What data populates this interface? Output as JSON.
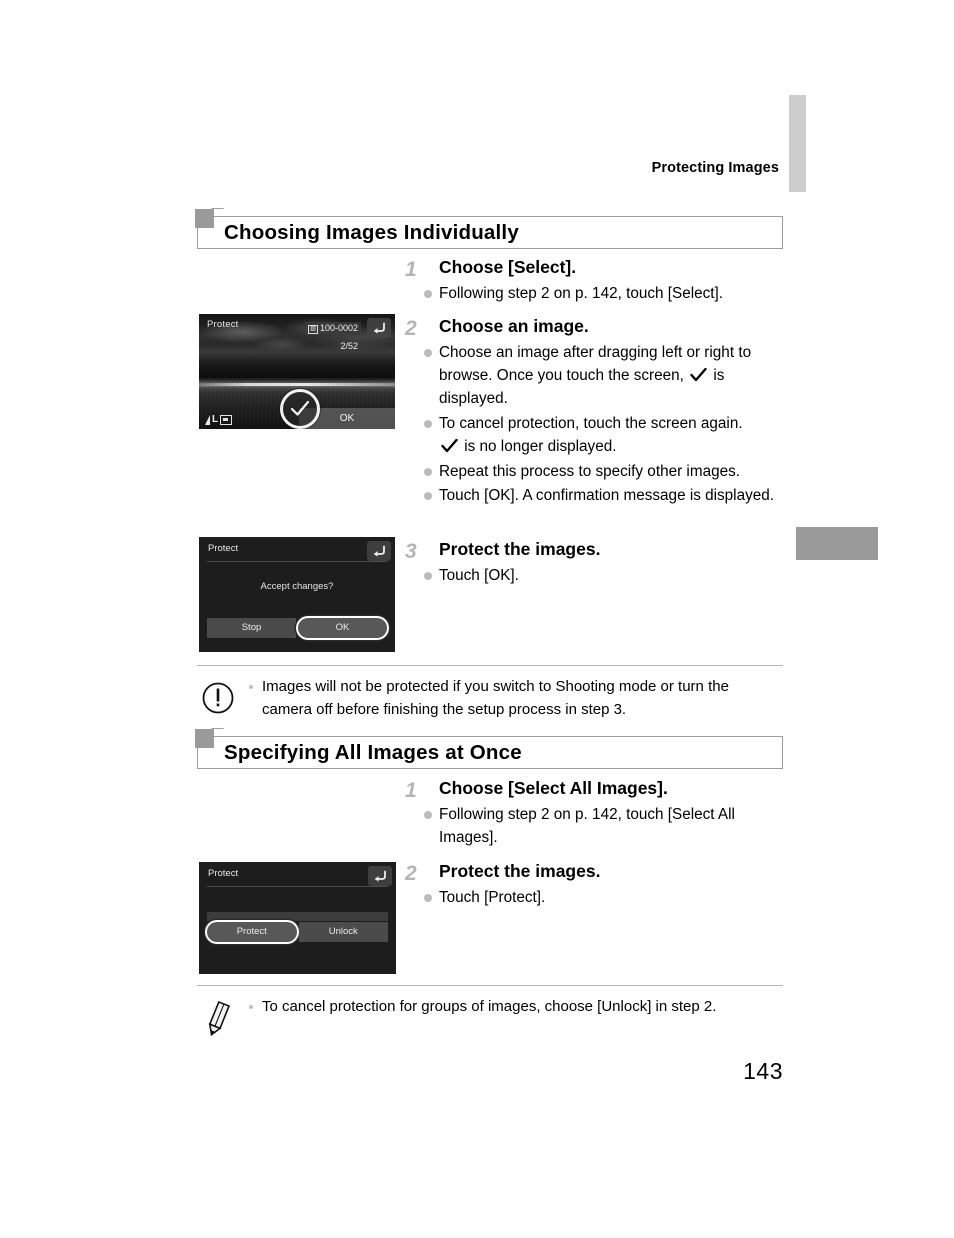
{
  "page": {
    "running_header": "Protecting Images",
    "page_number": "143"
  },
  "sections": [
    {
      "title": "Choosing Images Individually",
      "steps": [
        {
          "number": "1",
          "title": "Choose [Select].",
          "bullets": [
            "Following step 2 on p. 142, touch [Select]."
          ]
        },
        {
          "number": "2",
          "title": "Choose an image.",
          "bullets": [
            "Choose an image after dragging left or right to browse. Once you touch the screen, ✓ is displayed.",
            "To cancel protection, touch the screen again. ✓ is no longer displayed.",
            "Repeat this process to specify other images.",
            "Touch [OK]. A confirmation message is displayed."
          ]
        },
        {
          "number": "3",
          "title": "Protect the images.",
          "bullets": [
            "Touch [OK]."
          ]
        }
      ]
    },
    {
      "title": "Specifying All Images at Once",
      "steps": [
        {
          "number": "1",
          "title": "Choose [Select All Images].",
          "bullets": [
            "Following step 2 on p. 142, touch [Select All Images]."
          ]
        },
        {
          "number": "2",
          "title": "Protect the images.",
          "bullets": [
            "Touch [Protect]."
          ]
        }
      ]
    }
  ],
  "step2_bullet_parts": {
    "b1_pre": "Choose an image after dragging left or right to browse. Once you touch the screen,",
    "b1_post": "is displayed.",
    "b2_pre": "To cancel protection, touch the screen again.",
    "b2_post": "is no longer displayed.",
    "b3": "Repeat this process to specify other images.",
    "b4": "Touch [OK]. A confirmation message is displayed."
  },
  "screens": {
    "image_select": {
      "label": "Protect",
      "file_number": "100-0002",
      "image_count": "2/52",
      "memory_icon": "MEM",
      "ok_label": "OK",
      "quality_label": "L",
      "back_icon": "return-arrow-icon",
      "check_icon": "checkmark-icon"
    },
    "confirm": {
      "label": "Protect",
      "message": "Accept changes?",
      "buttons": [
        {
          "label": "Stop",
          "selected": false
        },
        {
          "label": "OK",
          "selected": true
        }
      ],
      "back_icon": "return-arrow-icon"
    },
    "all_images": {
      "label": "Protect",
      "buttons": [
        {
          "label": "Protect",
          "selected": true
        },
        {
          "label": "Unlock",
          "selected": false
        }
      ],
      "back_icon": "return-arrow-icon"
    }
  },
  "notes": [
    {
      "icon": "warning-exclamation-icon",
      "text": "Images will not be protected if you switch to Shooting mode or turn the camera off before finishing the setup process in step 3."
    },
    {
      "icon": "pencil-note-icon",
      "text": "To cancel protection for groups of images, choose [Unlock] in step 2."
    }
  ],
  "colors": {
    "tab_light": "#cdcdcd",
    "tab_dark": "#9a9a9a",
    "rule": "#b5b5b5",
    "step_number": "#b4b4b4",
    "bullet": "#bcbcbc"
  }
}
